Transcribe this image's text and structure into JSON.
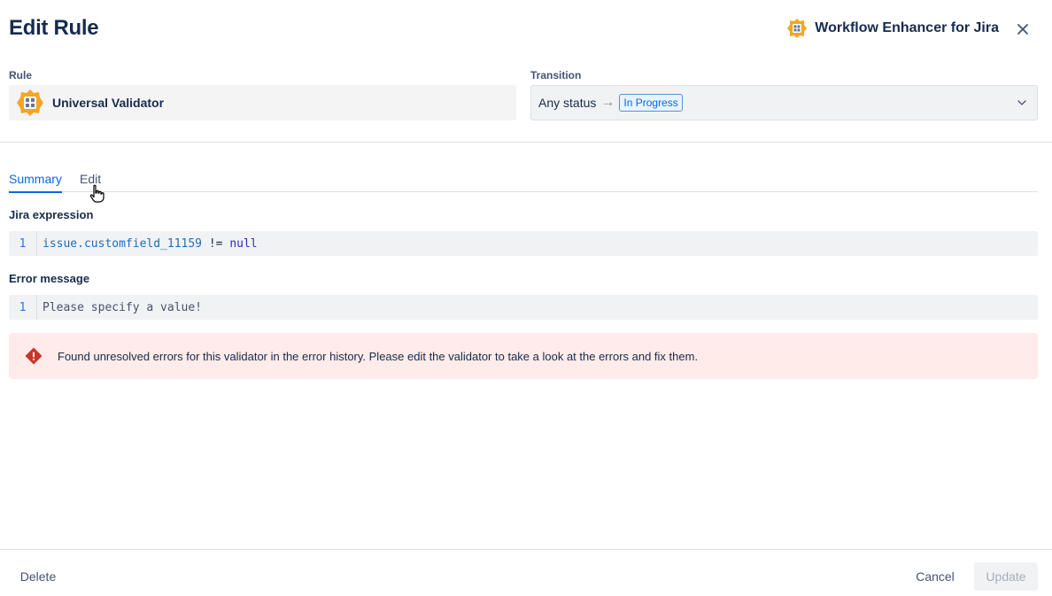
{
  "header": {
    "title": "Edit Rule",
    "app_name": "Workflow Enhancer for Jira",
    "close_icon": "close-icon"
  },
  "rule": {
    "label": "Rule",
    "name": "Universal Validator",
    "icon": "validator-logo-icon"
  },
  "transition": {
    "label": "Transition",
    "from": "Any status",
    "arrow": "→",
    "to": "In Progress"
  },
  "tabs": [
    {
      "label": "Summary",
      "active": true
    },
    {
      "label": "Edit",
      "active": false
    }
  ],
  "expression": {
    "label": "Jira expression",
    "line_number": "1",
    "code_prop": "issue.customfield_11159",
    "code_op": " != ",
    "code_kw": "null"
  },
  "error_message": {
    "label": "Error message",
    "line_number": "1",
    "text": "Please specify a value!"
  },
  "alert": {
    "text": "Found unresolved errors for this validator in the error history. Please edit the validator to take a look at the errors and fix them.",
    "icon": "error-icon",
    "color": "#c9372c"
  },
  "footer": {
    "delete_label": "Delete",
    "cancel_label": "Cancel",
    "update_label": "Update"
  },
  "colors": {
    "accent": "#0c66e4",
    "error_bg": "#ffebe9"
  }
}
